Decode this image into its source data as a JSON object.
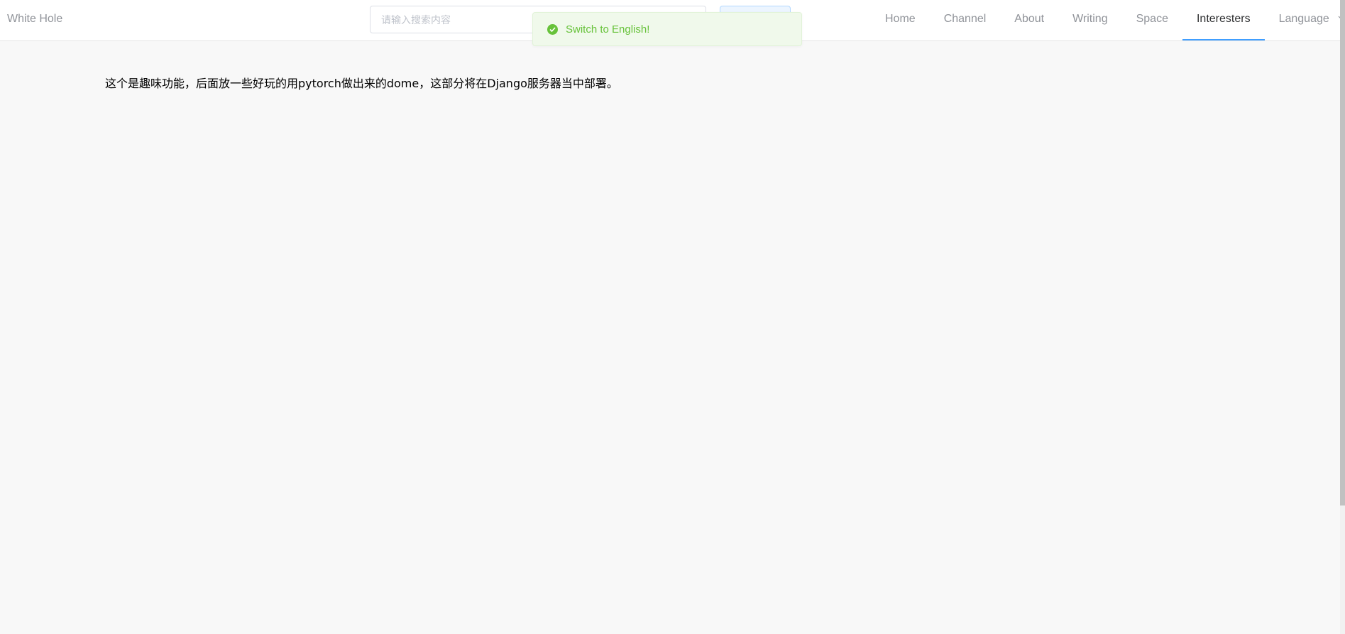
{
  "header": {
    "brand": "White Hole",
    "search": {
      "placeholder": "请输入搜索内容",
      "value": "",
      "button_label": ""
    },
    "nav": [
      {
        "label": "Home"
      },
      {
        "label": "Channel"
      },
      {
        "label": "About"
      },
      {
        "label": "Writing"
      },
      {
        "label": "Space"
      },
      {
        "label": "Interesters",
        "active": true
      },
      {
        "label": "Language",
        "dropdown": true
      }
    ]
  },
  "toast": {
    "icon": "check-circle-icon",
    "message": "Switch to English!",
    "color": "#67c23a"
  },
  "main": {
    "text": "这个是趣味功能，后面放一些好玩的用pytorch做出来的dome，这部分将在Django服务器当中部署。"
  },
  "colors": {
    "accent": "#409eff",
    "success": "#67c23a",
    "nav_text": "#909399",
    "nav_active_text": "#303133"
  }
}
